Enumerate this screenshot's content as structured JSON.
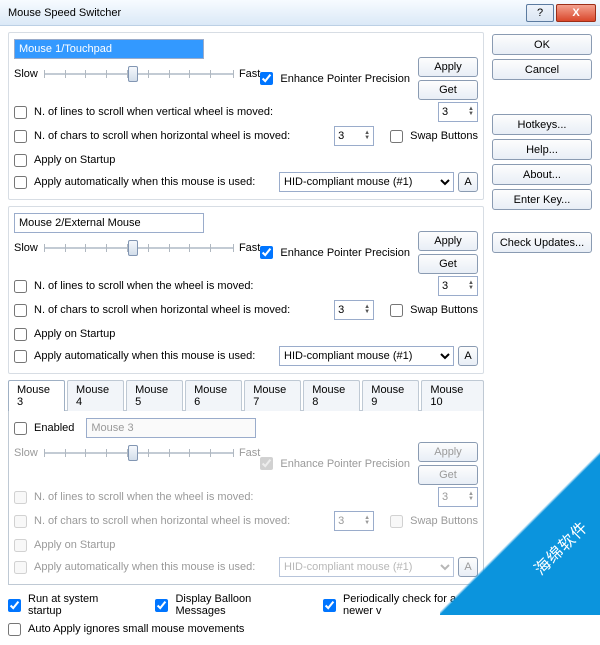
{
  "window": {
    "title": "Mouse Speed Switcher",
    "help": "?",
    "close": "X"
  },
  "side": {
    "ok": "OK",
    "cancel": "Cancel",
    "hotkeys": "Hotkeys...",
    "help": "Help...",
    "about": "About...",
    "enterkey": "Enter Key...",
    "check": "Check Updates..."
  },
  "common": {
    "slow": "Slow",
    "fast": "Fast",
    "enhance": "Enhance Pointer Precision",
    "apply": "Apply",
    "get": "Get",
    "lines_vertical": "N. of lines to scroll when vertical wheel is moved:",
    "lines_wheel": "N. of lines to scroll when the wheel is moved:",
    "chars": "N. of chars to scroll when  horizontal wheel is moved:",
    "applystartup": "Apply on Startup",
    "autoapply": "Apply automatically when this mouse is used:",
    "swap": "Swap Buttons",
    "spin_val": "3",
    "hid": "HID-compliant mouse (#1)",
    "a": "A"
  },
  "m1": {
    "name": "Mouse 1/Touchpad"
  },
  "m2": {
    "name": "Mouse 2/External Mouse"
  },
  "tabs": {
    "t3": "Mouse 3",
    "t4": "Mouse 4",
    "t5": "Mouse 5",
    "t6": "Mouse 6",
    "t7": "Mouse 7",
    "t8": "Mouse 8",
    "t9": "Mouse 9",
    "t10": "Mouse 10",
    "enabled": "Enabled",
    "name": "Mouse 3"
  },
  "footer": {
    "run": "Run at system startup",
    "balloon": "Display Balloon Messages",
    "periodic": "Periodically check for a newer v",
    "autoignore": "Auto Apply ignores small mouse movements"
  },
  "watermark": "海绵软件"
}
